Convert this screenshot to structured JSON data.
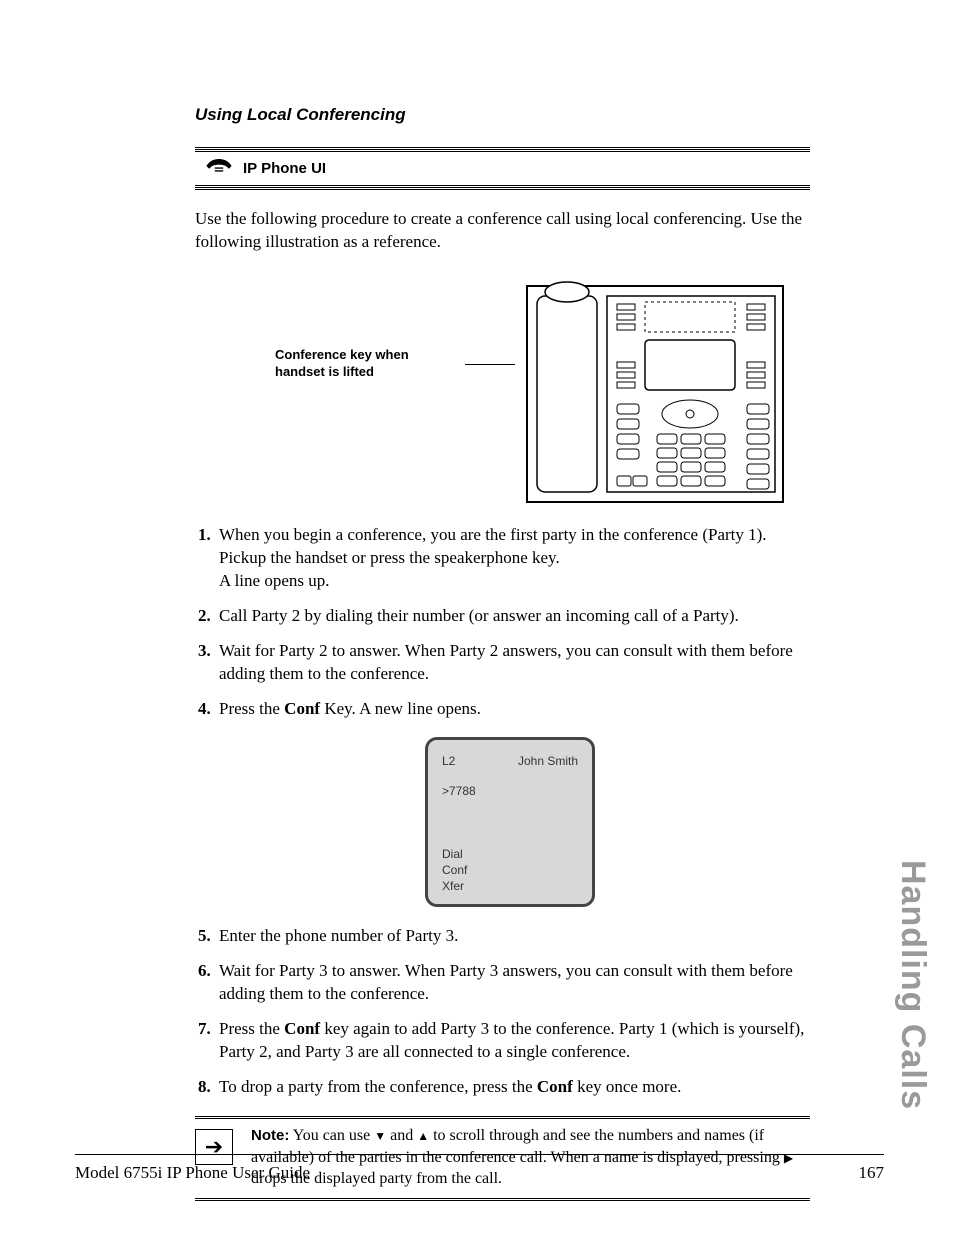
{
  "section_title": "Using Local Conferencing",
  "ui_bar_label": "IP Phone UI",
  "intro": "Use the following procedure to create a conference call using local conferencing. Use the following illustration as a reference.",
  "figure1_caption": "Conference key when handset is lifted",
  "steps": {
    "s1a": "When you begin a conference, you are the first party in the conference (Party 1). Pickup the handset or press the speakerphone key.",
    "s1b": "A line opens up.",
    "s2": "Call Party 2 by dialing their number (or answer an incoming call of a Party).",
    "s3": "Wait for Party 2 to answer. When Party 2 answers, you can consult with them before adding them to the conference.",
    "s4a": "Press the ",
    "s4b": " Key. A new line opens.",
    "s5": "Enter the phone number of Party 3.",
    "s6": "Wait for Party 3 to answer. When Party 3 answers, you can consult with them before adding them to the conference.",
    "s7a": "Press the ",
    "s7b": " key again to add Party 3 to the conference. Party 1 (which is yourself), Party 2, and Party 3 are all connected to a single conference.",
    "s8a": "To drop a party from the conference, press the ",
    "s8b": " key once more."
  },
  "conf_label": "Conf",
  "lcd": {
    "line": "L2",
    "name": "John Smith",
    "dialed": ">7788",
    "soft1": "Dial",
    "soft2": "Conf",
    "soft3": "Xfer"
  },
  "note": {
    "label": "Note:",
    "t1": " You can use ",
    "t2": " and ",
    "t3": " to scroll through and see the numbers and names (if available) of the parties in the conference call. When a name is displayed, pressing ",
    "t4": " drops the displayed party from the call."
  },
  "side_tab": "Handling Calls",
  "footer_left": "Model 6755i IP Phone User Guide",
  "footer_right": "167"
}
